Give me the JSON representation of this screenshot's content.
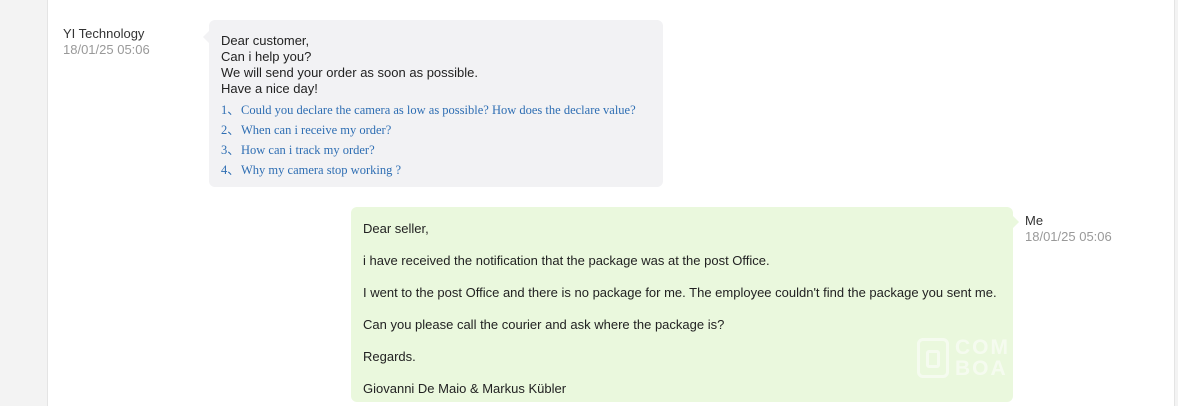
{
  "seller": {
    "name": "YI Technology",
    "timestamp": "18/01/25 05:06",
    "greeting_lines": [
      "Dear customer,",
      "Can i help you?",
      "We will send your order as soon as possible.",
      "Have a nice day!"
    ],
    "faq": [
      {
        "num": "1、",
        "text": "Could you declare the camera as low as possible? How does the declare value?"
      },
      {
        "num": "2、",
        "text": "When can i receive my order?"
      },
      {
        "num": "3、",
        "text": "How can i track my order?"
      },
      {
        "num": "4、",
        "text": "Why my camera stop working ?"
      }
    ]
  },
  "buyer": {
    "name": "Me",
    "timestamp": "18/01/25 05:06",
    "paragraphs": [
      "Dear seller,",
      "i have received the notification that the package was at the post Office.",
      "I went to the post Office and there is no package for me. The employee couldn't find the package you sent me.",
      "Can you please call the courier and ask where the package is?",
      "Regards.",
      "Giovanni De Maio & Markus Kübler"
    ]
  },
  "watermark": {
    "line1": "COM",
    "line2": "BOA"
  },
  "colors": {
    "seller_bubble": "#f2f2f4",
    "buyer_bubble": "#eaf8dd",
    "faq_link": "#2e6eb3",
    "timestamp": "#999999"
  }
}
